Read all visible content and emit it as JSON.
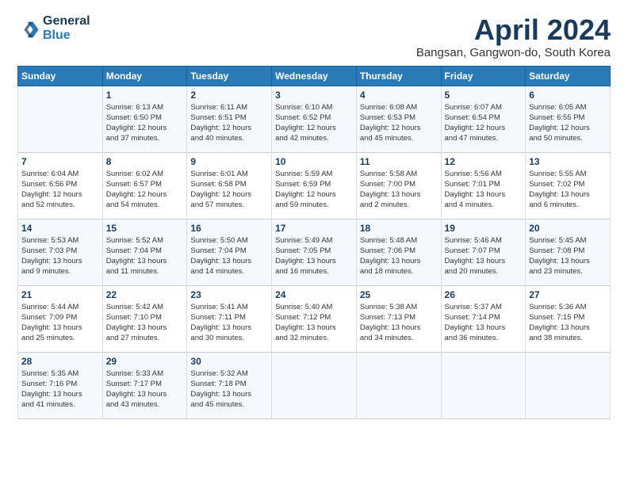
{
  "header": {
    "logo_line1": "General",
    "logo_line2": "Blue",
    "month_title": "April 2024",
    "location": "Bangsan, Gangwon-do, South Korea"
  },
  "weekdays": [
    "Sunday",
    "Monday",
    "Tuesday",
    "Wednesday",
    "Thursday",
    "Friday",
    "Saturday"
  ],
  "weeks": [
    [
      {
        "day": "",
        "info": ""
      },
      {
        "day": "1",
        "info": "Sunrise: 6:13 AM\nSunset: 6:50 PM\nDaylight: 12 hours\nand 37 minutes."
      },
      {
        "day": "2",
        "info": "Sunrise: 6:11 AM\nSunset: 6:51 PM\nDaylight: 12 hours\nand 40 minutes."
      },
      {
        "day": "3",
        "info": "Sunrise: 6:10 AM\nSunset: 6:52 PM\nDaylight: 12 hours\nand 42 minutes."
      },
      {
        "day": "4",
        "info": "Sunrise: 6:08 AM\nSunset: 6:53 PM\nDaylight: 12 hours\nand 45 minutes."
      },
      {
        "day": "5",
        "info": "Sunrise: 6:07 AM\nSunset: 6:54 PM\nDaylight: 12 hours\nand 47 minutes."
      },
      {
        "day": "6",
        "info": "Sunrise: 6:05 AM\nSunset: 6:55 PM\nDaylight: 12 hours\nand 50 minutes."
      }
    ],
    [
      {
        "day": "7",
        "info": "Sunrise: 6:04 AM\nSunset: 6:56 PM\nDaylight: 12 hours\nand 52 minutes."
      },
      {
        "day": "8",
        "info": "Sunrise: 6:02 AM\nSunset: 6:57 PM\nDaylight: 12 hours\nand 54 minutes."
      },
      {
        "day": "9",
        "info": "Sunrise: 6:01 AM\nSunset: 6:58 PM\nDaylight: 12 hours\nand 57 minutes."
      },
      {
        "day": "10",
        "info": "Sunrise: 5:59 AM\nSunset: 6:59 PM\nDaylight: 12 hours\nand 59 minutes."
      },
      {
        "day": "11",
        "info": "Sunrise: 5:58 AM\nSunset: 7:00 PM\nDaylight: 13 hours\nand 2 minutes."
      },
      {
        "day": "12",
        "info": "Sunrise: 5:56 AM\nSunset: 7:01 PM\nDaylight: 13 hours\nand 4 minutes."
      },
      {
        "day": "13",
        "info": "Sunrise: 5:55 AM\nSunset: 7:02 PM\nDaylight: 13 hours\nand 6 minutes."
      }
    ],
    [
      {
        "day": "14",
        "info": "Sunrise: 5:53 AM\nSunset: 7:03 PM\nDaylight: 13 hours\nand 9 minutes."
      },
      {
        "day": "15",
        "info": "Sunrise: 5:52 AM\nSunset: 7:04 PM\nDaylight: 13 hours\nand 11 minutes."
      },
      {
        "day": "16",
        "info": "Sunrise: 5:50 AM\nSunset: 7:04 PM\nDaylight: 13 hours\nand 14 minutes."
      },
      {
        "day": "17",
        "info": "Sunrise: 5:49 AM\nSunset: 7:05 PM\nDaylight: 13 hours\nand 16 minutes."
      },
      {
        "day": "18",
        "info": "Sunrise: 5:48 AM\nSunset: 7:06 PM\nDaylight: 13 hours\nand 18 minutes."
      },
      {
        "day": "19",
        "info": "Sunrise: 5:46 AM\nSunset: 7:07 PM\nDaylight: 13 hours\nand 20 minutes."
      },
      {
        "day": "20",
        "info": "Sunrise: 5:45 AM\nSunset: 7:08 PM\nDaylight: 13 hours\nand 23 minutes."
      }
    ],
    [
      {
        "day": "21",
        "info": "Sunrise: 5:44 AM\nSunset: 7:09 PM\nDaylight: 13 hours\nand 25 minutes."
      },
      {
        "day": "22",
        "info": "Sunrise: 5:42 AM\nSunset: 7:10 PM\nDaylight: 13 hours\nand 27 minutes."
      },
      {
        "day": "23",
        "info": "Sunrise: 5:41 AM\nSunset: 7:11 PM\nDaylight: 13 hours\nand 30 minutes."
      },
      {
        "day": "24",
        "info": "Sunrise: 5:40 AM\nSunset: 7:12 PM\nDaylight: 13 hours\nand 32 minutes."
      },
      {
        "day": "25",
        "info": "Sunrise: 5:38 AM\nSunset: 7:13 PM\nDaylight: 13 hours\nand 34 minutes."
      },
      {
        "day": "26",
        "info": "Sunrise: 5:37 AM\nSunset: 7:14 PM\nDaylight: 13 hours\nand 36 minutes."
      },
      {
        "day": "27",
        "info": "Sunrise: 5:36 AM\nSunset: 7:15 PM\nDaylight: 13 hours\nand 38 minutes."
      }
    ],
    [
      {
        "day": "28",
        "info": "Sunrise: 5:35 AM\nSunset: 7:16 PM\nDaylight: 13 hours\nand 41 minutes."
      },
      {
        "day": "29",
        "info": "Sunrise: 5:33 AM\nSunset: 7:17 PM\nDaylight: 13 hours\nand 43 minutes."
      },
      {
        "day": "30",
        "info": "Sunrise: 5:32 AM\nSunset: 7:18 PM\nDaylight: 13 hours\nand 45 minutes."
      },
      {
        "day": "",
        "info": ""
      },
      {
        "day": "",
        "info": ""
      },
      {
        "day": "",
        "info": ""
      },
      {
        "day": "",
        "info": ""
      }
    ]
  ]
}
